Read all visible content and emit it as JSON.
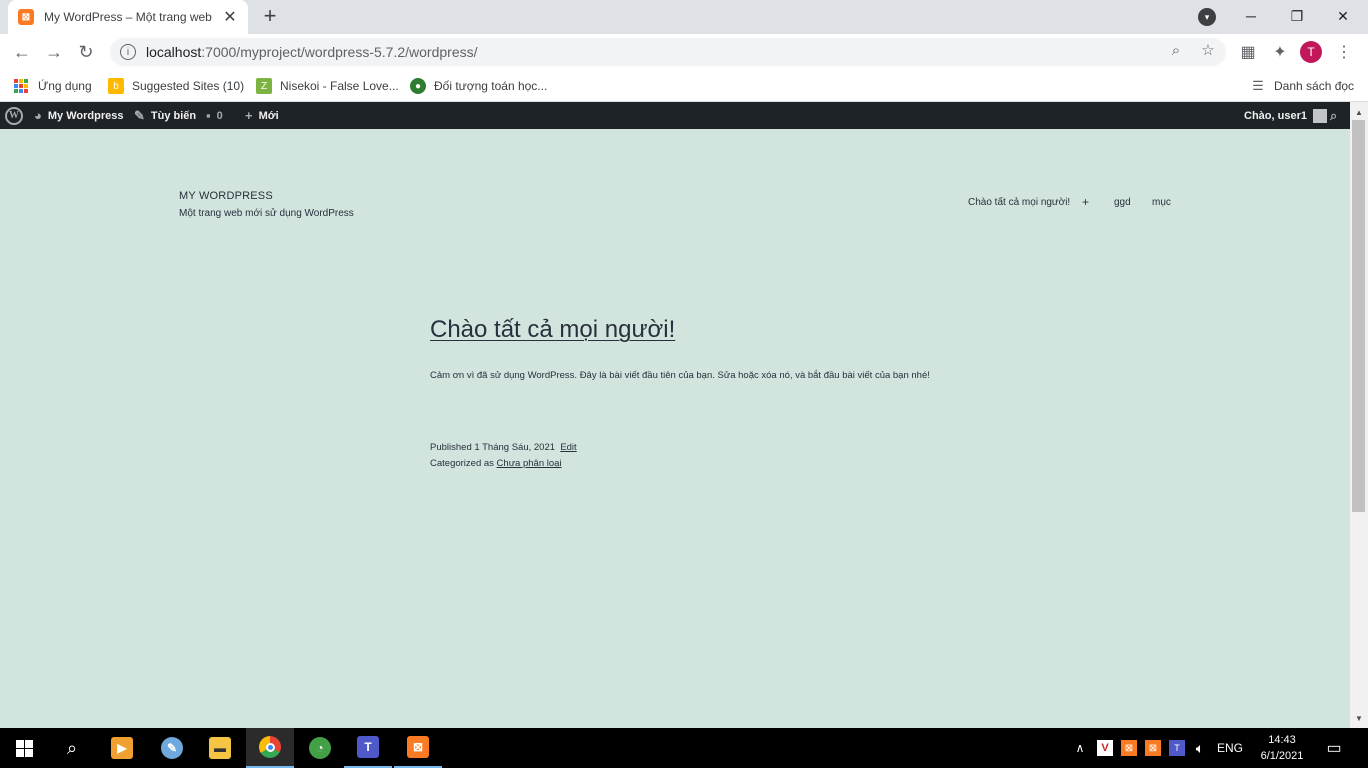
{
  "browser": {
    "tab_title": "My WordPress – Một trang web mới sử dụng WordPress",
    "url_host": "localhost",
    "url_rest": ":7000/myproject/wordpress-5.7.2/wordpress/",
    "avatar_letter": "T",
    "bookmarks": [
      {
        "label": "Ứng dụng",
        "icon": "apps-grid-icon"
      },
      {
        "label": "Suggested Sites (10)",
        "icon": "bing-icon"
      },
      {
        "label": "Nisekoi - False Love...",
        "icon": "z-icon"
      },
      {
        "label": "Đối tượng toán học...",
        "icon": "globe-icon"
      }
    ],
    "reading_list": "Danh sách đọc"
  },
  "adminbar": {
    "site_name": "My Wordpress",
    "customize": "Tùy biến",
    "comments_count": "0",
    "new_label": "Mới",
    "greeting": "Chào, user1"
  },
  "site": {
    "title": "MY WORDPRESS",
    "description": "Một trang web mới sử dụng WordPress",
    "menu": [
      "Chào tất cả mọi người!",
      "+",
      "ggd",
      "mục"
    ]
  },
  "post": {
    "title": "Chào tất cả mọi người!",
    "body": "Cảm ơn vì đã sử dụng WordPress. Đây là bài viết đầu tiên của bạn. Sửa hoặc xóa nó, và bắt đầu bài viết của bạn nhé!",
    "published_prefix": "Published",
    "published_date": "1 Tháng Sáu, 2021",
    "edit_label": "Edit",
    "categorized_prefix": "Categorized as",
    "category": "Chưa phân loại"
  },
  "taskbar": {
    "language": "ENG",
    "time": "14:43",
    "date": "6/1/2021"
  },
  "colors": {
    "page_bg": "#d1e4dd",
    "adminbar_bg": "#1d2327",
    "text": "#28303d"
  }
}
